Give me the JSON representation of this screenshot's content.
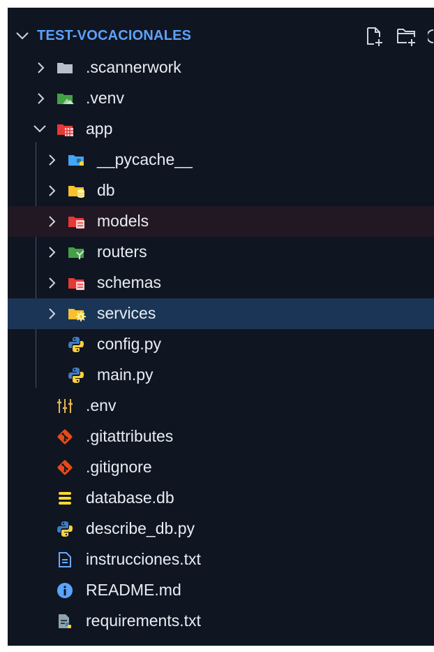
{
  "explorer": {
    "title": "TEST-VOCACIONALES",
    "actions": [
      {
        "name": "new-file-icon"
      },
      {
        "name": "new-folder-icon"
      },
      {
        "name": "refresh-icon"
      }
    ],
    "items": [
      {
        "label": ".scannerwork",
        "type": "folder",
        "icon": "folder-gray-icon",
        "expanded": false
      },
      {
        "label": ".venv",
        "type": "folder",
        "icon": "folder-venv-icon",
        "expanded": false
      },
      {
        "label": "app",
        "type": "folder",
        "icon": "folder-app-icon",
        "expanded": true
      },
      {
        "label": "__pycache__",
        "type": "folder",
        "icon": "folder-python-icon",
        "expanded": false
      },
      {
        "label": "db",
        "type": "folder",
        "icon": "folder-database-icon",
        "expanded": false
      },
      {
        "label": "models",
        "type": "folder",
        "icon": "folder-models-icon",
        "expanded": false
      },
      {
        "label": "routers",
        "type": "folder",
        "icon": "folder-routes-icon",
        "expanded": false
      },
      {
        "label": "schemas",
        "type": "folder",
        "icon": "folder-schemas-icon",
        "expanded": false
      },
      {
        "label": "services",
        "type": "folder",
        "icon": "folder-services-icon",
        "expanded": false,
        "selected": true
      },
      {
        "label": "config.py",
        "type": "file",
        "icon": "python-icon"
      },
      {
        "label": "main.py",
        "type": "file",
        "icon": "python-icon"
      },
      {
        "label": ".env",
        "type": "file",
        "icon": "tune-icon"
      },
      {
        "label": ".gitattributes",
        "type": "file",
        "icon": "git-icon"
      },
      {
        "label": ".gitignore",
        "type": "file",
        "icon": "git-icon"
      },
      {
        "label": "database.db",
        "type": "file",
        "icon": "database-icon"
      },
      {
        "label": "describe_db.py",
        "type": "file",
        "icon": "python-icon"
      },
      {
        "label": "instrucciones.txt",
        "type": "file",
        "icon": "text-document-icon"
      },
      {
        "label": "README.md",
        "type": "file",
        "icon": "info-icon"
      },
      {
        "label": "requirements.txt",
        "type": "file",
        "icon": "requirements-icon"
      }
    ]
  },
  "colors": {
    "background": "#0f1621",
    "title": "#5ea2ff",
    "selection": "#1a3556",
    "hover": "#221824",
    "text": "#e9edf3"
  }
}
